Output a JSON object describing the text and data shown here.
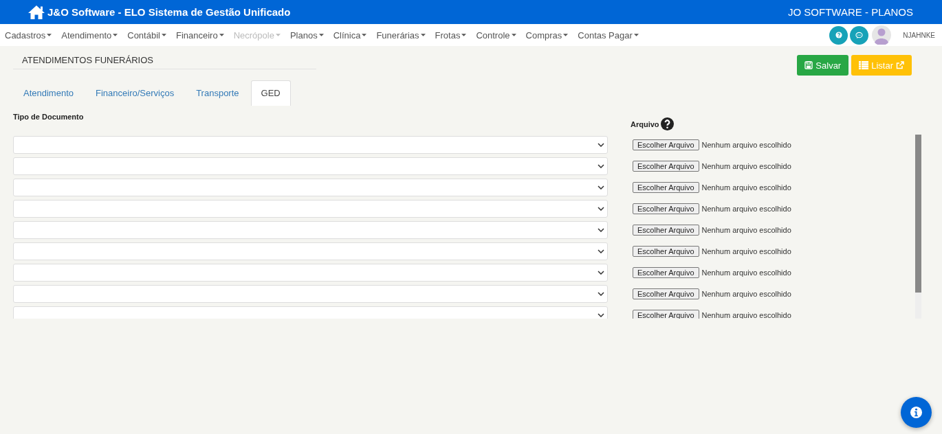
{
  "header": {
    "title": "J&O Software - ELO Sistema de Gestão Unificado",
    "right_title": "JO SOFTWARE - PLANOS"
  },
  "menu": [
    {
      "label": "Cadastros",
      "disabled": false
    },
    {
      "label": "Atendimento",
      "disabled": false
    },
    {
      "label": "Contábil",
      "disabled": false
    },
    {
      "label": "Financeiro",
      "disabled": false
    },
    {
      "label": "Necrópole",
      "disabled": true
    },
    {
      "label": "Planos",
      "disabled": false
    },
    {
      "label": "Clínica",
      "disabled": false
    },
    {
      "label": "Funerárias",
      "disabled": false
    },
    {
      "label": "Frotas",
      "disabled": false
    },
    {
      "label": "Controle",
      "disabled": false
    },
    {
      "label": "Compras",
      "disabled": false
    },
    {
      "label": "Contas Pagar",
      "disabled": false
    }
  ],
  "user": {
    "name": "NJAHNKE"
  },
  "page_title": "ATENDIMENTOS FUNERÁRIOS",
  "buttons": [
    {
      "label": "Salvar",
      "kind": "save"
    },
    {
      "label": "Listar",
      "kind": "list"
    }
  ],
  "tabs": [
    {
      "label": "Atendimento",
      "selected": false
    },
    {
      "label": "Financeiro/Serviços",
      "selected": false
    },
    {
      "label": "Transporte",
      "selected": false
    },
    {
      "label": "GED",
      "selected": true
    }
  ],
  "form": {
    "type_label": "Tipo de Documento",
    "file_label": "Arquivo",
    "rows": [
      {
        "button": "Escolher Arquivo",
        "file": "Nenhum arquivo escolhido"
      },
      {
        "button": "Escolher Arquivo",
        "file": "Nenhum arquivo escolhido"
      },
      {
        "button": "Escolher Arquivo",
        "file": "Nenhum arquivo escolhido"
      },
      {
        "button": "Escolher Arquivo",
        "file": "Nenhum arquivo escolhido"
      },
      {
        "button": "Escolher Arquivo",
        "file": "Nenhum arquivo escolhido"
      },
      {
        "button": "Escolher Arquivo",
        "file": "Nenhum arquivo escolhido"
      },
      {
        "button": "Escolher Arquivo",
        "file": "Nenhum arquivo escolhido"
      },
      {
        "button": "Escolher Arquivo",
        "file": "Nenhum arquivo escolhido"
      },
      {
        "button": "Escolher Arquivo",
        "file": "Nenhum arquivo escolhido"
      }
    ]
  }
}
